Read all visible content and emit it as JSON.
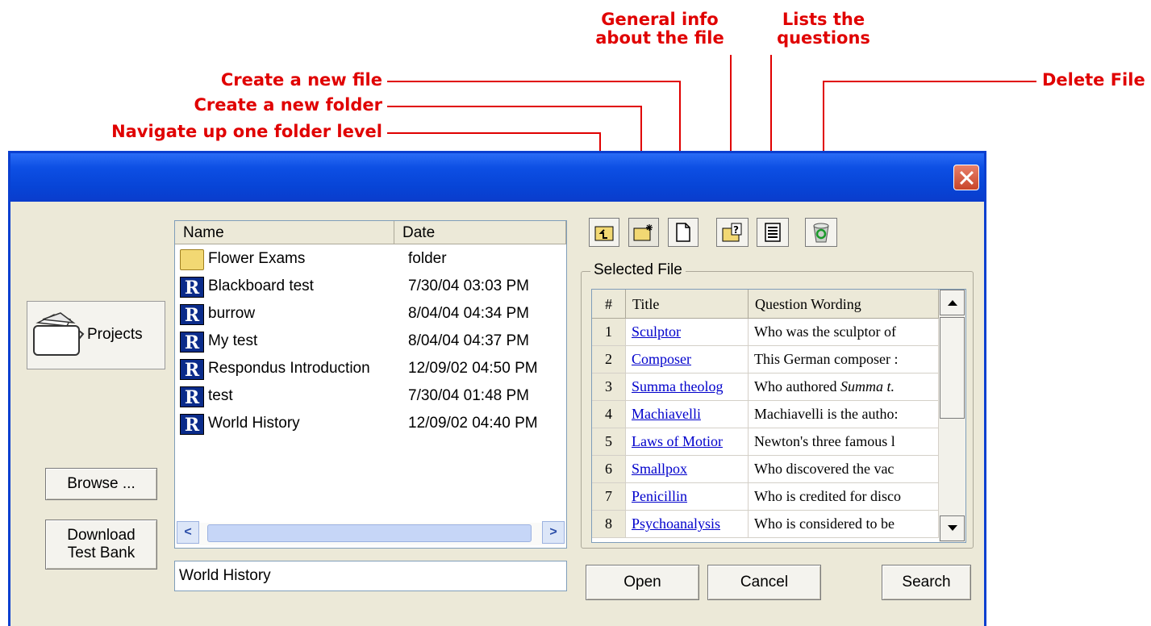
{
  "callouts": {
    "general_info": "General info\nabout the file",
    "lists_questions": "Lists the\nquestions",
    "new_file": "Create a new file",
    "new_folder": "Create a new folder",
    "navigate_up": "Navigate up one folder level",
    "delete_file": "Delete File"
  },
  "sidebar": {
    "projects_label": "Projects",
    "browse_label": "Browse ...",
    "download_label": "Download\nTest Bank"
  },
  "file_list": {
    "columns": [
      "Name",
      "Date"
    ],
    "rows": [
      {
        "name": "Flower Exams",
        "date": "folder",
        "icon": "folder-icon"
      },
      {
        "name": "Blackboard test",
        "date": "7/30/04  03:03 PM",
        "icon": "respondus-file-icon"
      },
      {
        "name": "burrow",
        "date": "8/04/04  04:34 PM",
        "icon": "respondus-file-icon"
      },
      {
        "name": "My test",
        "date": "8/04/04  04:37 PM",
        "icon": "respondus-file-icon"
      },
      {
        "name": "Respondus Introduction",
        "date": "12/09/02  04:50 PM",
        "icon": "respondus-file-icon"
      },
      {
        "name": "test",
        "date": "7/30/04  01:48 PM",
        "icon": "respondus-file-icon"
      },
      {
        "name": "World History",
        "date": "12/09/02  04:40 PM",
        "icon": "respondus-file-icon"
      }
    ]
  },
  "filename_input": "World History",
  "selected_file": {
    "label": "Selected File",
    "columns": [
      "#",
      "Title",
      "Question Wording"
    ],
    "rows": [
      {
        "num": "1",
        "title": "Sculptor",
        "wording": "Who was the sculptor of"
      },
      {
        "num": "2",
        "title": "Composer",
        "wording": "This German composer :"
      },
      {
        "num": "3",
        "title": "Summa theolog",
        "wording": "Who authored Summa t."
      },
      {
        "num": "4",
        "title": "Machiavelli",
        "wording": "Machiavelli is the autho:"
      },
      {
        "num": "5",
        "title": "Laws of Motior",
        "wording": "Newton's three famous l"
      },
      {
        "num": "6",
        "title": "Smallpox",
        "wording": "Who discovered the vac"
      },
      {
        "num": "7",
        "title": "Penicillin",
        "wording": "Who is credited for disco"
      },
      {
        "num": "8",
        "title": "Psychoanalysis",
        "wording": "Who is considered to be"
      }
    ]
  },
  "buttons": {
    "open": "Open",
    "cancel": "Cancel",
    "search": "Search"
  },
  "colors": {
    "callout": "#e00000",
    "titlebar": "#0744d6",
    "dialog_bg": "#ece9d8",
    "link": "#0000cc"
  }
}
